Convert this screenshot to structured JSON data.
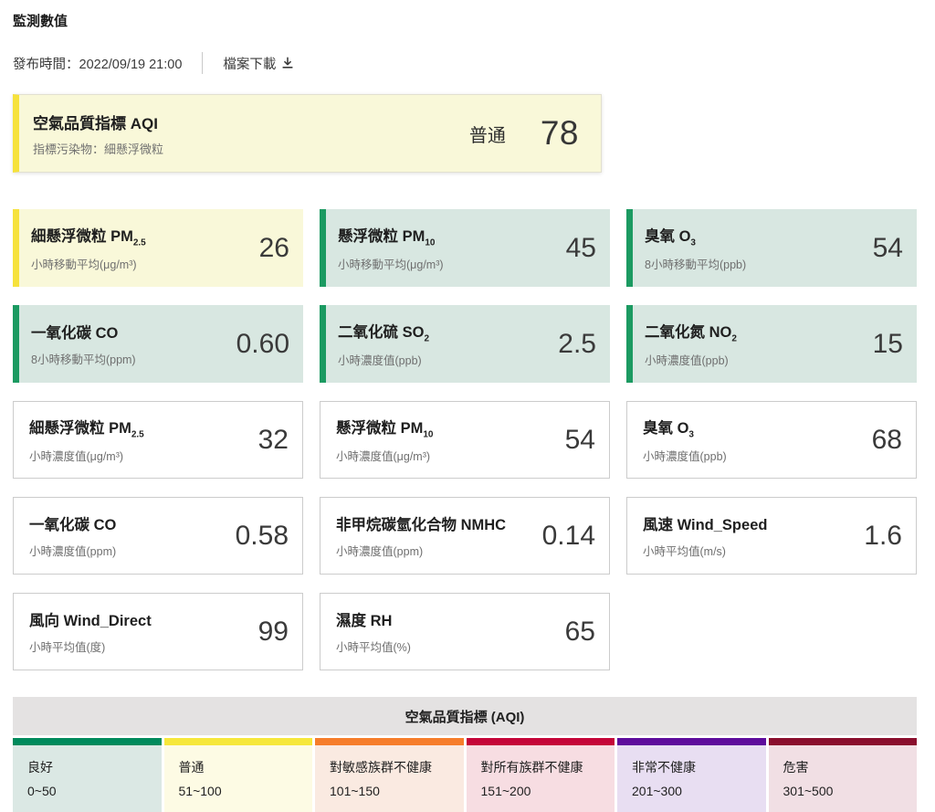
{
  "page": {
    "title": "監測數值",
    "publish_time_label": "發布時間：2022/09/19 21:00",
    "download_label": "檔案下載"
  },
  "aqi_summary": {
    "title": "空氣品質指標 AQI",
    "subtitle": "指標污染物：細懸浮微粒",
    "status": "普通",
    "value": "78",
    "accent_color": "#f6e23c",
    "bg_color": "#f9f8d9"
  },
  "card_styles": {
    "yellow": {
      "accent": "#f6e23c",
      "bg": "#f9f8d9"
    },
    "green": {
      "accent": "#1b9a61",
      "bg": "#d8e7e1"
    },
    "plain": {
      "accent": "",
      "bg": "#ffffff"
    }
  },
  "cards": [
    {
      "title": "細懸浮微粒 PM",
      "subscript": "2.5",
      "desc": "小時移動平均(μg/m³)",
      "value": "26",
      "style": "yellow"
    },
    {
      "title": "懸浮微粒 PM",
      "subscript": "10",
      "desc": "小時移動平均(μg/m³)",
      "value": "45",
      "style": "green"
    },
    {
      "title": "臭氧 O",
      "subscript": "3",
      "desc": "8小時移動平均(ppb)",
      "value": "54",
      "style": "green"
    },
    {
      "title": "一氧化碳 CO",
      "subscript": "",
      "desc": "8小時移動平均(ppm)",
      "value": "0.60",
      "style": "green"
    },
    {
      "title": "二氧化硫 SO",
      "subscript": "2",
      "desc": "小時濃度值(ppb)",
      "value": "2.5",
      "style": "green"
    },
    {
      "title": "二氧化氮 NO",
      "subscript": "2",
      "desc": "小時濃度值(ppb)",
      "value": "15",
      "style": "green"
    },
    {
      "title": "細懸浮微粒 PM",
      "subscript": "2.5",
      "desc": "小時濃度值(μg/m³)",
      "value": "32",
      "style": "plain"
    },
    {
      "title": "懸浮微粒 PM",
      "subscript": "10",
      "desc": "小時濃度值(μg/m³)",
      "value": "54",
      "style": "plain"
    },
    {
      "title": "臭氧 O",
      "subscript": "3",
      "desc": "小時濃度值(ppb)",
      "value": "68",
      "style": "plain"
    },
    {
      "title": "一氧化碳 CO",
      "subscript": "",
      "desc": "小時濃度值(ppm)",
      "value": "0.58",
      "style": "plain"
    },
    {
      "title": "非甲烷碳氫化合物 NMHC",
      "subscript": "",
      "desc": "小時濃度值(ppm)",
      "value": "0.14",
      "style": "plain"
    },
    {
      "title": "風速 Wind_Speed",
      "subscript": "",
      "desc": "小時平均值(m/s)",
      "value": "1.6",
      "style": "plain"
    },
    {
      "title": "風向 Wind_Direct",
      "subscript": "",
      "desc": "小時平均值(度)",
      "value": "99",
      "style": "plain"
    },
    {
      "title": "濕度 RH",
      "subscript": "",
      "desc": "小時平均值(%)",
      "value": "65",
      "style": "plain"
    }
  ],
  "legend": {
    "title": "空氣品質指標 (AQI)",
    "items": [
      {
        "label": "良好",
        "range": "0~50",
        "bar_color": "#008a5c",
        "bg_color": "#dbe8e4"
      },
      {
        "label": "普通",
        "range": "51~100",
        "bar_color": "#f6e73b",
        "bg_color": "#fdfbe4"
      },
      {
        "label": "對敏感族群不健康",
        "range": "101~150",
        "bar_color": "#f67d2b",
        "bg_color": "#faeae1"
      },
      {
        "label": "對所有族群不健康",
        "range": "151~200",
        "bar_color": "#c50538",
        "bg_color": "#f7dde2"
      },
      {
        "label": "非常不健康",
        "range": "201~300",
        "bar_color": "#5e0c9c",
        "bg_color": "#e8def2"
      },
      {
        "label": "危害",
        "range": "301~500",
        "bar_color": "#8a0e2d",
        "bg_color": "#f1dfe4"
      }
    ]
  }
}
